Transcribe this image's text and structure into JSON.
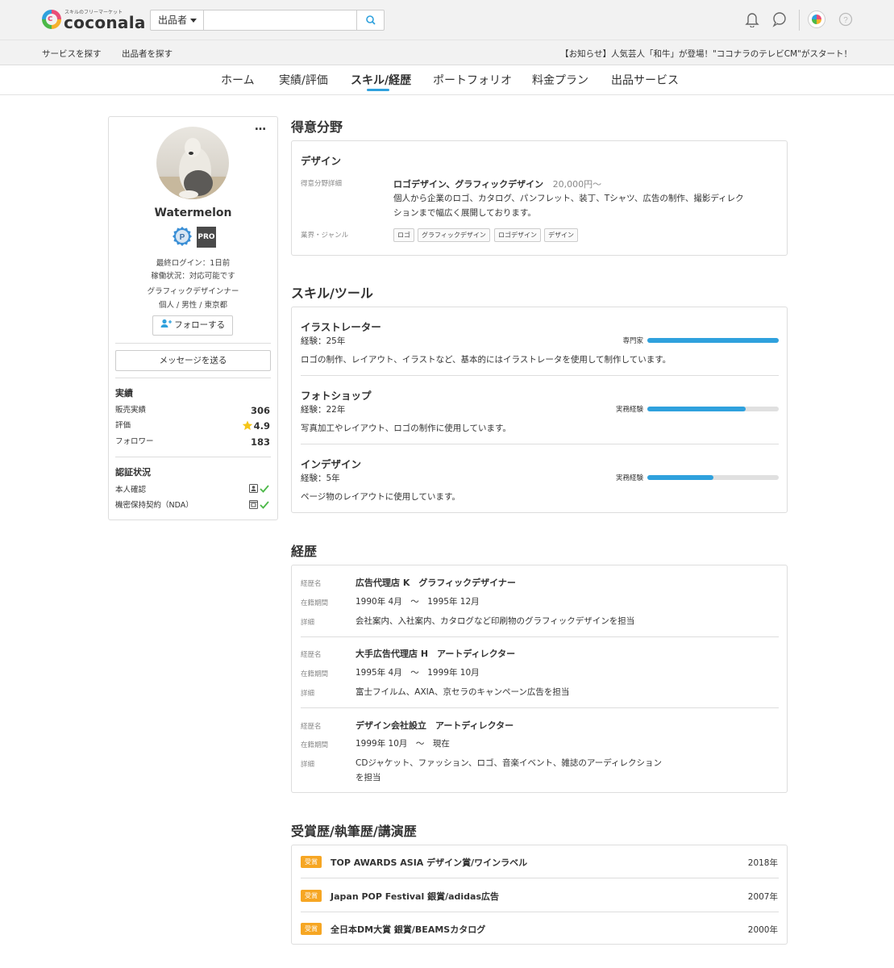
{
  "header": {
    "logo_tagline": "スキルのフリーマーケット",
    "logo_text": "coconala",
    "search_select": "出品者",
    "search_placeholder": ""
  },
  "util_bar": {
    "links": [
      "サービスを探す",
      "出品者を探す"
    ],
    "notice": "【お知らせ】人気芸人「和牛」が登場！\"ココナラのテレビCM\"がスタート！"
  },
  "nav": {
    "tabs": [
      "ホーム",
      "実績/評価",
      "スキル/経歴",
      "ポートフォリオ",
      "料金プラン",
      "出品サービス"
    ],
    "active": "スキル/経歴"
  },
  "profile": {
    "more": "…",
    "username": "Watermelon",
    "pro_badge": "PRO",
    "last_login": "最終ログイン：1日前",
    "status": "稼働状況：対応可能です",
    "job": "グラフィックデザインナー",
    "attrs": "個人 / 男性 / 東京都",
    "follow_label": "フォローする",
    "message_label": "メッセージを送る",
    "results_title": "実績",
    "results": [
      {
        "label": "販売実績",
        "value": "306"
      },
      {
        "label": "評価",
        "value": "4.9"
      },
      {
        "label": "フォロワー",
        "value": "183"
      }
    ],
    "verify_title": "認証状況",
    "verify": [
      "本人確認",
      "機密保持契約（NDA）"
    ]
  },
  "specialty": {
    "title": "得意分野",
    "category": "デザイン",
    "detail_label": "得意分野詳細",
    "detail_title": "ロゴデザイン、グラフィックデザイン",
    "price": "20,000円〜",
    "desc1": "個人から企業のロゴ、カタログ、パンフレット、装丁、Tシャツ、広告の制作、撮影ディレク",
    "desc2": "ションまで幅広く展開しております。",
    "genre_label": "業界・ジャンル",
    "tags": [
      "ロゴ",
      "グラフィックデザイン",
      "ロゴデザイン",
      "デザイン"
    ]
  },
  "skills": {
    "title": "スキル/ツール",
    "items": [
      {
        "name": "イラストレーター",
        "exp": "経験：25年",
        "level": "専門家",
        "ratio": 1.0,
        "desc": "ロゴの制作、レイアウト、イラストなど、基本的にはイラストレータを使用して制作しています。"
      },
      {
        "name": "フォトショップ",
        "exp": "経験：22年",
        "level": "実務経験",
        "ratio": 0.75,
        "desc": "写真加工やレイアウト、ロゴの制作に使用しています。"
      },
      {
        "name": "インデザイン",
        "exp": "経験：5年",
        "level": "実務経験",
        "ratio": 0.5,
        "desc": "ページ物のレイアウトに使用しています。"
      }
    ]
  },
  "career": {
    "title": "経歴",
    "labels": {
      "name": "経歴名",
      "period": "在籍期間",
      "detail": "詳細"
    },
    "items": [
      {
        "name": "広告代理店 K　グラフィックデザイナー",
        "period": "1990年 4月　〜　1995年 12月",
        "detail1": "会社案内、入社案内、カタログなど印刷物のグラフィックデザインを担当",
        "detail2": ""
      },
      {
        "name": "大手広告代理店 H　アートディレクター",
        "period": "1995年 4月　〜　1999年 10月",
        "detail1": "富士フイルム、AXIA、京セラのキャンペーン広告を担当",
        "detail2": ""
      },
      {
        "name": "デザイン会社設立　アートディレクター",
        "period": "1999年 10月　〜　現在",
        "detail1": "CDジャケット、ファッション、ロゴ、音楽イベント、雑誌のアーディレクション",
        "detail2": "を担当"
      }
    ]
  },
  "awards": {
    "title": "受賞歴/執筆歴/講演歴",
    "tag": "受賞",
    "items": [
      {
        "name": "TOP AWARDS ASIA デザイン賞/ワインラベル",
        "year": "2018年"
      },
      {
        "name": "Japan POP Festival 銀賞/adidas広告",
        "year": "2007年"
      },
      {
        "name": "全日本DM大賞 銀賞/BEAMSカタログ",
        "year": "2000年"
      }
    ]
  },
  "colors": {
    "accent": "#2fa1dd",
    "award": "#f6a623",
    "star": "#f5c518",
    "check": "#4cb848"
  }
}
